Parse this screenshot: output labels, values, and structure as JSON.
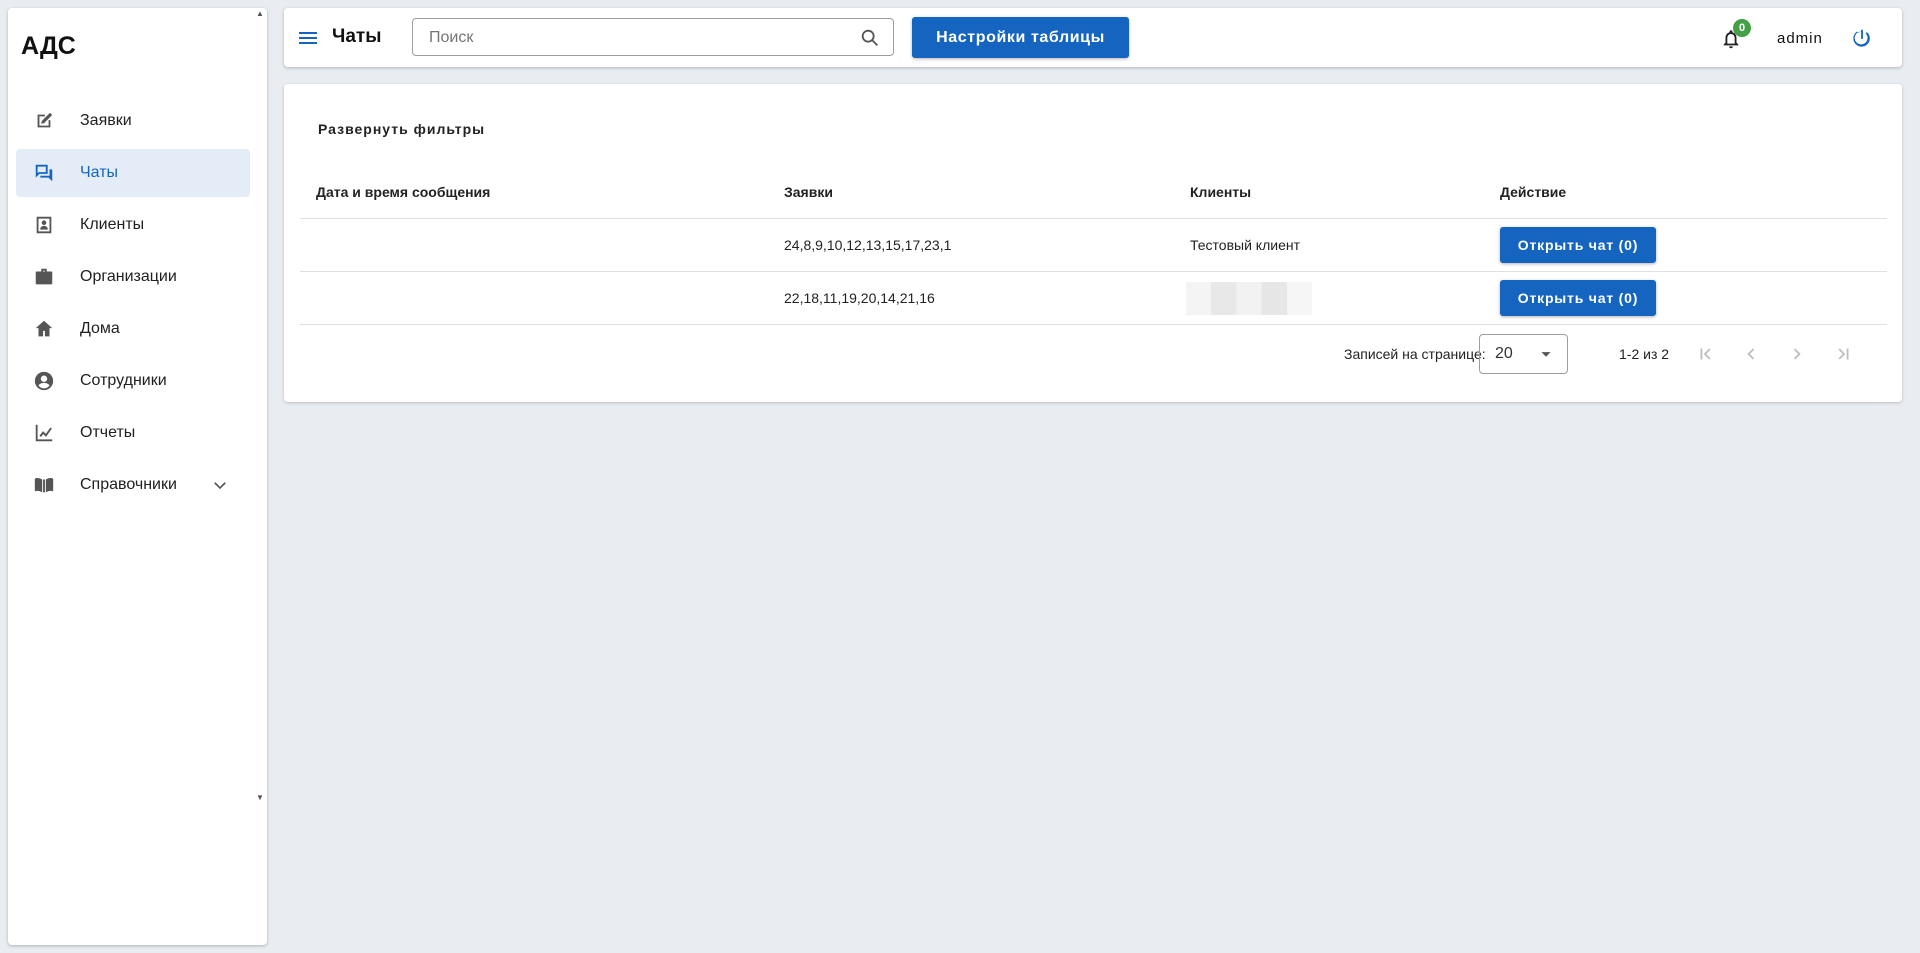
{
  "app": {
    "brand": "АДС"
  },
  "sidebar": {
    "items": [
      {
        "label": "Заявки",
        "icon": "edit-icon",
        "active": false
      },
      {
        "label": "Чаты",
        "icon": "chat-icon",
        "active": true
      },
      {
        "label": "Клиенты",
        "icon": "contact-card-icon",
        "active": false
      },
      {
        "label": "Организации",
        "icon": "briefcase-icon",
        "active": false
      },
      {
        "label": "Дома",
        "icon": "home-icon",
        "active": false
      },
      {
        "label": "Сотрудники",
        "icon": "account-circle-icon",
        "active": false
      },
      {
        "label": "Отчеты",
        "icon": "line-chart-icon",
        "active": false
      },
      {
        "label": "Справочники",
        "icon": "book-icon",
        "active": false,
        "expandable": true
      }
    ]
  },
  "header": {
    "title": "Чаты",
    "search_placeholder": "Поиск",
    "search_value": "",
    "settings_button": "Настройки таблицы",
    "notifications_count": "0",
    "username": "admin"
  },
  "main": {
    "filters_toggle": "Развернуть фильтры",
    "table": {
      "columns": [
        "Дата и время сообщения",
        "Заявки",
        "Клиенты",
        "Действие"
      ],
      "rows": [
        {
          "datetime": "",
          "requests": "24,8,9,10,12,13,15,17,23,1",
          "client": "Тестовый клиент",
          "action": "Открыть чат (0)"
        },
        {
          "datetime": "",
          "requests": "22,18,11,19,20,14,21,16",
          "client": "",
          "action": "Открыть чат (0)"
        }
      ]
    },
    "pagination": {
      "rows_per_page_label": "Записей на странице:",
      "rows_per_page": "20",
      "range": "1-2 из 2"
    }
  },
  "colors": {
    "accent": "#1565c0",
    "active_nav_bg": "#e3ecf7",
    "badge": "#43a047",
    "background": "#e9edf1"
  }
}
